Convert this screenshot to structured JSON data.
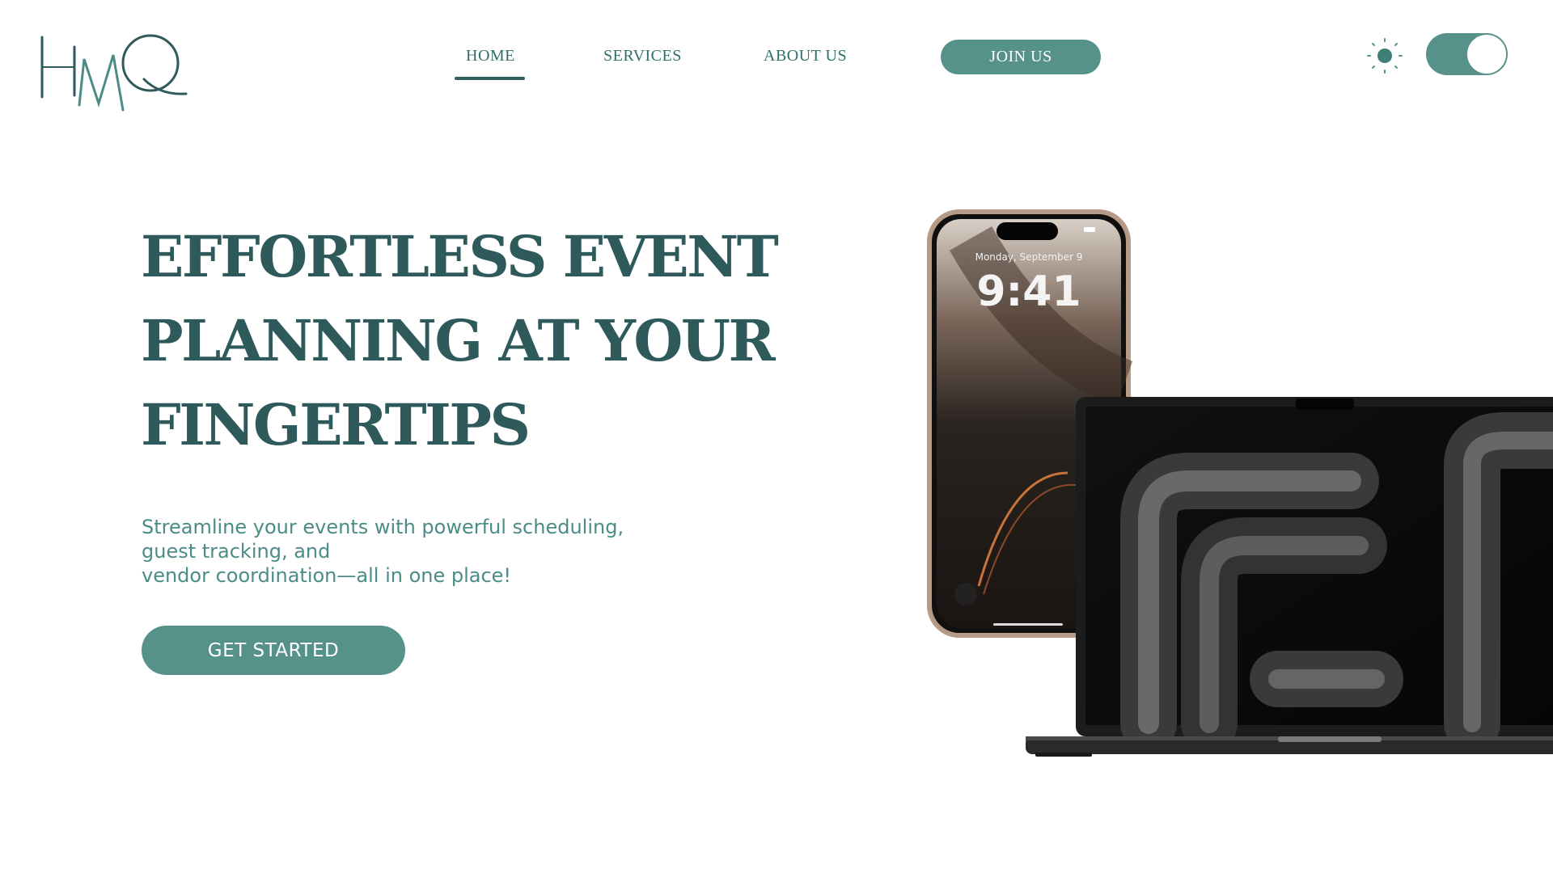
{
  "brand": {
    "logo_text": "HMQ"
  },
  "nav": {
    "items": [
      {
        "label": "HOME",
        "active": true
      },
      {
        "label": "SERVICES",
        "active": false
      },
      {
        "label": "ABOUT US",
        "active": false
      }
    ],
    "join_label": "JOIN US"
  },
  "theme": {
    "icon": "sun-icon",
    "dark_mode": false
  },
  "hero": {
    "title_lines": [
      "EFFORTLESS EVENT",
      "PLANNING AT YOUR",
      "FINGERTIPS"
    ],
    "subtitle_lines": [
      "Streamline your events with powerful scheduling,",
      "guest tracking, and",
      "vendor coordination—all in one place!"
    ],
    "cta_label": "GET STARTED"
  },
  "phone": {
    "date": "Monday, September 9",
    "time": "9:41"
  },
  "colors": {
    "accent": "#56918a",
    "title": "#2f5a5b",
    "text": "#4b8c86"
  }
}
